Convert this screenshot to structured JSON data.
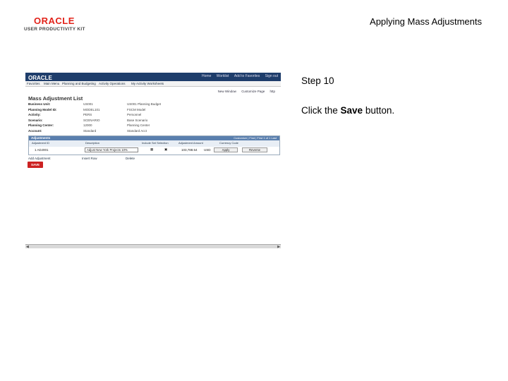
{
  "header": {
    "logo_brand": "ORACLE",
    "logo_sub": "USER PRODUCTIVITY KIT",
    "doc_title": "Applying Mass Adjustments"
  },
  "screenshot": {
    "brand": "ORACLE",
    "top_links": [
      "Home",
      "Worklist",
      "Add to Favorites",
      "Sign out"
    ],
    "menu_items": [
      "Favorites",
      "Main Menu",
      "Planning and Budgeting",
      "Activity Operations",
      "My Activity Worksheets"
    ],
    "page_links": [
      "New Window",
      "Customize Page",
      "http"
    ],
    "page_title": "Mass Adjustment List",
    "fields": [
      {
        "label": "Business Unit:",
        "v1": "US001",
        "v2": "US001 Planning Budget"
      },
      {
        "label": "Planning Model ID:",
        "v1": "MODEL101",
        "v2": "FSCM Model"
      },
      {
        "label": "Activity:",
        "v1": "PERS",
        "v2": "Personnel"
      },
      {
        "label": "Scenario:",
        "v1": "SCENARIO",
        "v2": "Base Scenario"
      },
      {
        "label": "Planning Center:",
        "v1": "12000",
        "v2": "Planning Center"
      },
      {
        "label": "Account:",
        "v1": "Standard",
        "v2": "Standard Acct"
      }
    ],
    "grid": {
      "title": "Adjustments",
      "nav": "Customize | Find | First 1 of 1 Last",
      "columns": [
        "Adjustment ID",
        "Description",
        "Include Set Selection",
        "Adjustment Amount",
        "Currency Code"
      ],
      "row": {
        "id": "1 ADJ001",
        "description": "Adjust New York Projects 10%",
        "amount": "103,788.54",
        "currency": "USD",
        "apply_label": "Apply",
        "reverse_label": "Reverse"
      }
    },
    "foot_links": [
      "Add Adjustment",
      "Insert Row",
      "Delete"
    ],
    "save_label": "SAVE"
  },
  "step": {
    "label": "Step 10",
    "instruction_pre": "Click the ",
    "instruction_bold": "Save",
    "instruction_post": " button."
  }
}
